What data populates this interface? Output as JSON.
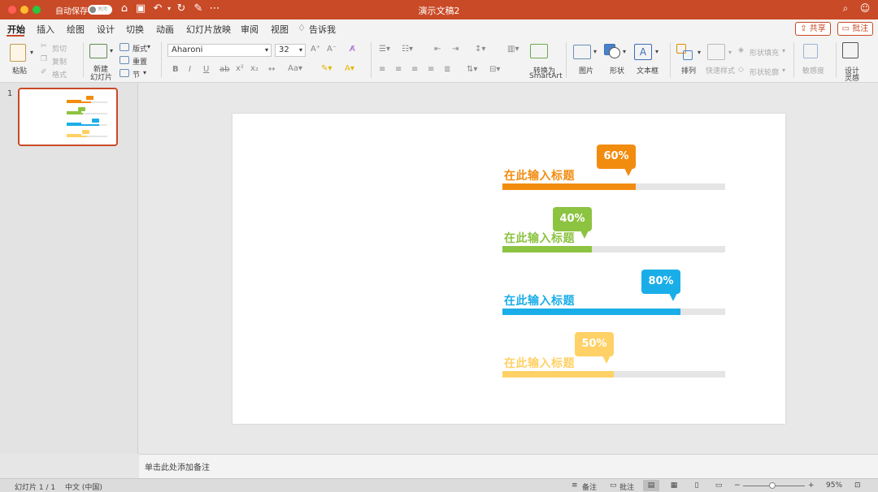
{
  "titlebar": {
    "autosave_label": "自动保存",
    "autosave_state": "关闭",
    "doc_title": "演示文稿2"
  },
  "tabs": [
    "开始",
    "插入",
    "绘图",
    "设计",
    "切换",
    "动画",
    "幻灯片放映",
    "审阅",
    "视图",
    "告诉我"
  ],
  "share_label": "共享",
  "comment_label": "批注",
  "ribbon": {
    "paste": "粘贴",
    "cut": "剪切",
    "copy": "复制",
    "format": "格式",
    "new_slide": "新建",
    "new_slide_2": "幻灯片",
    "layout": "版式",
    "reset": "重置",
    "section": "节",
    "font": "Aharoni",
    "font_size": "32",
    "smartart": "转换为",
    "smartart_2": "SmartArt",
    "picture": "图片",
    "shape": "形状",
    "textbox": "文本框",
    "arrange": "排列",
    "quick_styles": "快速样式",
    "shape_fill": "形状填充",
    "shape_outline": "形状轮廓",
    "sensitivity": "敏感度",
    "designer": "设计",
    "designer_2": "灵感"
  },
  "slide_number": "1",
  "slide": {
    "bars": [
      {
        "title": "在此输入标题",
        "percent": "60%",
        "value": 60,
        "color": "#f28c0f"
      },
      {
        "title": "在此输入标题",
        "percent": "40%",
        "value": 40,
        "color": "#8cc341"
      },
      {
        "title": "在此输入标题",
        "percent": "80%",
        "value": 80,
        "color": "#1aaee8"
      },
      {
        "title": "在此输入标题",
        "percent": "50%",
        "value": 50,
        "color": "#ffd166"
      }
    ]
  },
  "notes_placeholder": "单击此处添加备注",
  "status": {
    "slide_info": "幻灯片 1 / 1",
    "language": "中文 (中国)",
    "notes": "备注",
    "comments": "批注",
    "zoom": "95%"
  }
}
